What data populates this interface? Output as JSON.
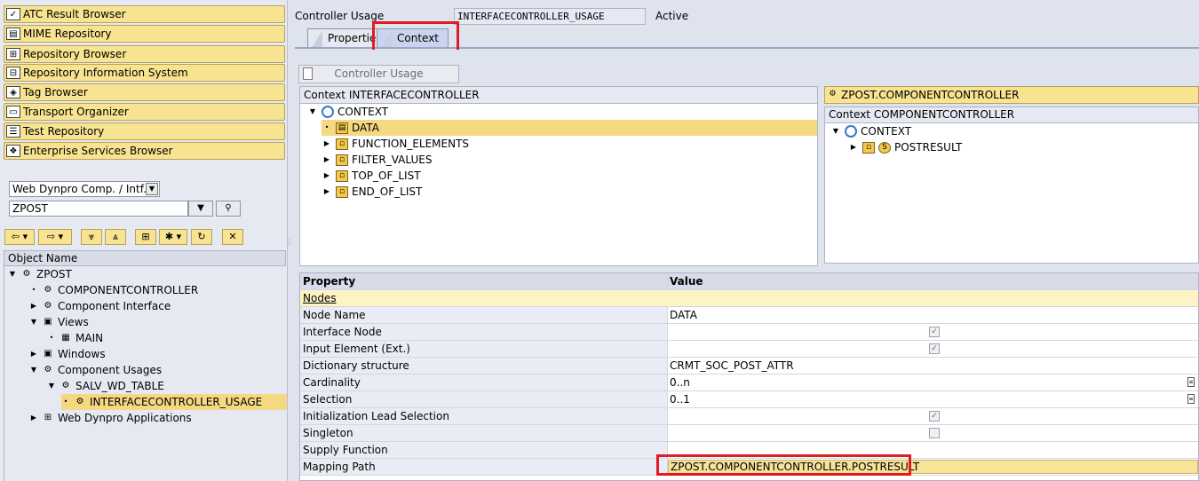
{
  "nav_buttons": [
    {
      "label": "ATC Result Browser",
      "icon": "check-list-icon"
    },
    {
      "label": "MIME Repository",
      "icon": "mime-icon"
    },
    {
      "label": "Repository Browser",
      "icon": "hierarchy-icon"
    },
    {
      "label": "Repository Information System",
      "icon": "info-system-icon"
    },
    {
      "label": "Tag Browser",
      "icon": "tag-icon"
    },
    {
      "label": "Transport Organizer",
      "icon": "truck-icon"
    },
    {
      "label": "Test Repository",
      "icon": "test-icon"
    },
    {
      "label": "Enterprise Services Browser",
      "icon": "services-icon"
    }
  ],
  "object_selector": {
    "type": "Web Dynpro Comp. / Intf.",
    "name": "ZPOST"
  },
  "object_tree": {
    "header": "Object Name",
    "items": [
      {
        "label": "ZPOST"
      },
      {
        "label": "COMPONENTCONTROLLER"
      },
      {
        "label": "Component Interface"
      },
      {
        "label": "Views"
      },
      {
        "label": "MAIN"
      },
      {
        "label": "Windows"
      },
      {
        "label": "Component Usages"
      },
      {
        "label": "SALV_WD_TABLE"
      },
      {
        "label": "INTERFACECONTROLLER_USAGE"
      },
      {
        "label": "Web Dynpro Applications"
      }
    ]
  },
  "header": {
    "controller_usage_label": "Controller Usage",
    "controller_usage_value": "INTERFACECONTROLLER_USAGE",
    "status": "Active"
  },
  "tabs": [
    {
      "label": "Properties"
    },
    {
      "label": "Context"
    }
  ],
  "controller_usage_button": "Controller Usage",
  "context_left": {
    "title": "Context INTERFACECONTROLLER",
    "root": "CONTEXT",
    "nodes": [
      "DATA",
      "FUNCTION_ELEMENTS",
      "FILTER_VALUES",
      "TOP_OF_LIST",
      "END_OF_LIST"
    ]
  },
  "context_right": {
    "button": "ZPOST.COMPONENTCONTROLLER",
    "title": "Context COMPONENTCONTROLLER",
    "root": "CONTEXT",
    "nodes": [
      "POSTRESULT"
    ]
  },
  "properties": {
    "col_property": "Property",
    "col_value": "Value",
    "group": "Nodes",
    "rows": [
      {
        "property": "Node Name",
        "value": "DATA"
      },
      {
        "property": "Interface Node",
        "value": "",
        "checked": true
      },
      {
        "property": "Input Element (Ext.)",
        "value": "",
        "checked": true
      },
      {
        "property": "Dictionary structure",
        "value": "CRMT_SOC_POST_ATTR"
      },
      {
        "property": "Cardinality",
        "value": "0..n"
      },
      {
        "property": "Selection",
        "value": "0..1"
      },
      {
        "property": "Initialization Lead Selection",
        "value": "",
        "checked": true
      },
      {
        "property": "Singleton",
        "value": "",
        "checked": false
      },
      {
        "property": "Supply Function",
        "value": ""
      },
      {
        "property": "Mapping Path",
        "value": "ZPOST.COMPONENTCONTROLLER.POSTRESULT"
      }
    ]
  }
}
